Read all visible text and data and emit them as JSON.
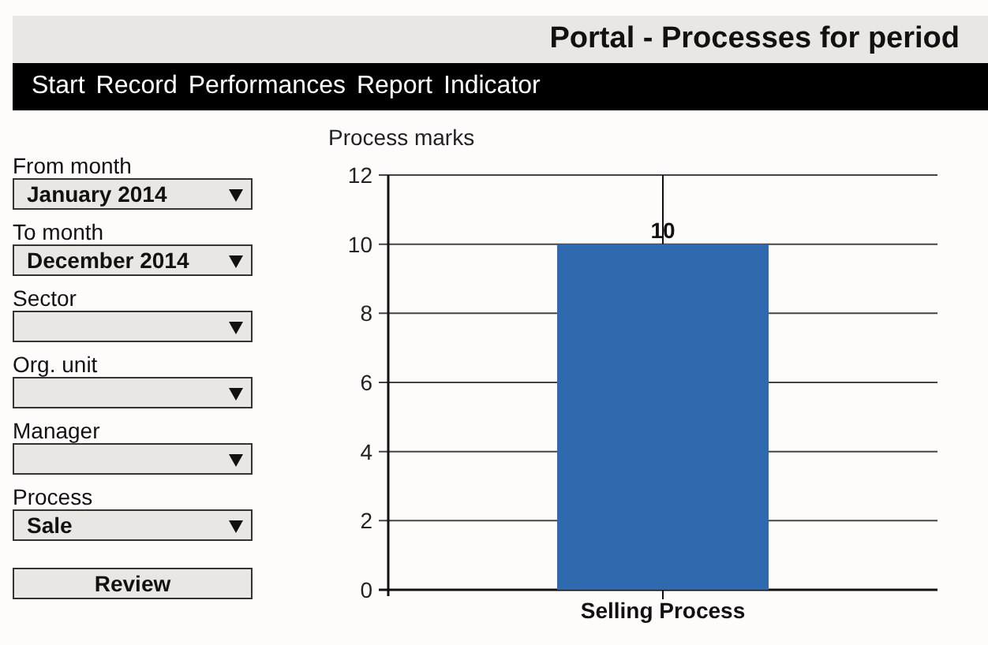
{
  "header": {
    "title": "Portal - Processes for period"
  },
  "menu": [
    {
      "label": "Start"
    },
    {
      "label": "Record"
    },
    {
      "label": "Performances"
    },
    {
      "label": "Report"
    },
    {
      "label": "Indicator"
    }
  ],
  "filters": [
    {
      "label": "From month",
      "value": "January 2014"
    },
    {
      "label": "To month",
      "value": "December 2014"
    },
    {
      "label": "Sector"
    },
    {
      "label": "Org. unit"
    },
    {
      "label": "Manager"
    },
    {
      "label": "Process",
      "value": "Sale"
    }
  ],
  "review_button": "Review",
  "chart": {
    "chart_data": {
      "type": "bar",
      "title": "Process marks",
      "categories": [
        "Selling Process"
      ],
      "series": [
        {
          "color": "#2e6aad",
          "values": [
            10
          ]
        }
      ],
      "ylim": [
        0,
        12
      ],
      "yticks": [
        0,
        2,
        4,
        6,
        8,
        10,
        12
      ],
      "grid": true,
      "ref_lines": [
        {
          "axis": "x",
          "value": "Selling Process"
        }
      ],
      "data_labels": true
    }
  }
}
